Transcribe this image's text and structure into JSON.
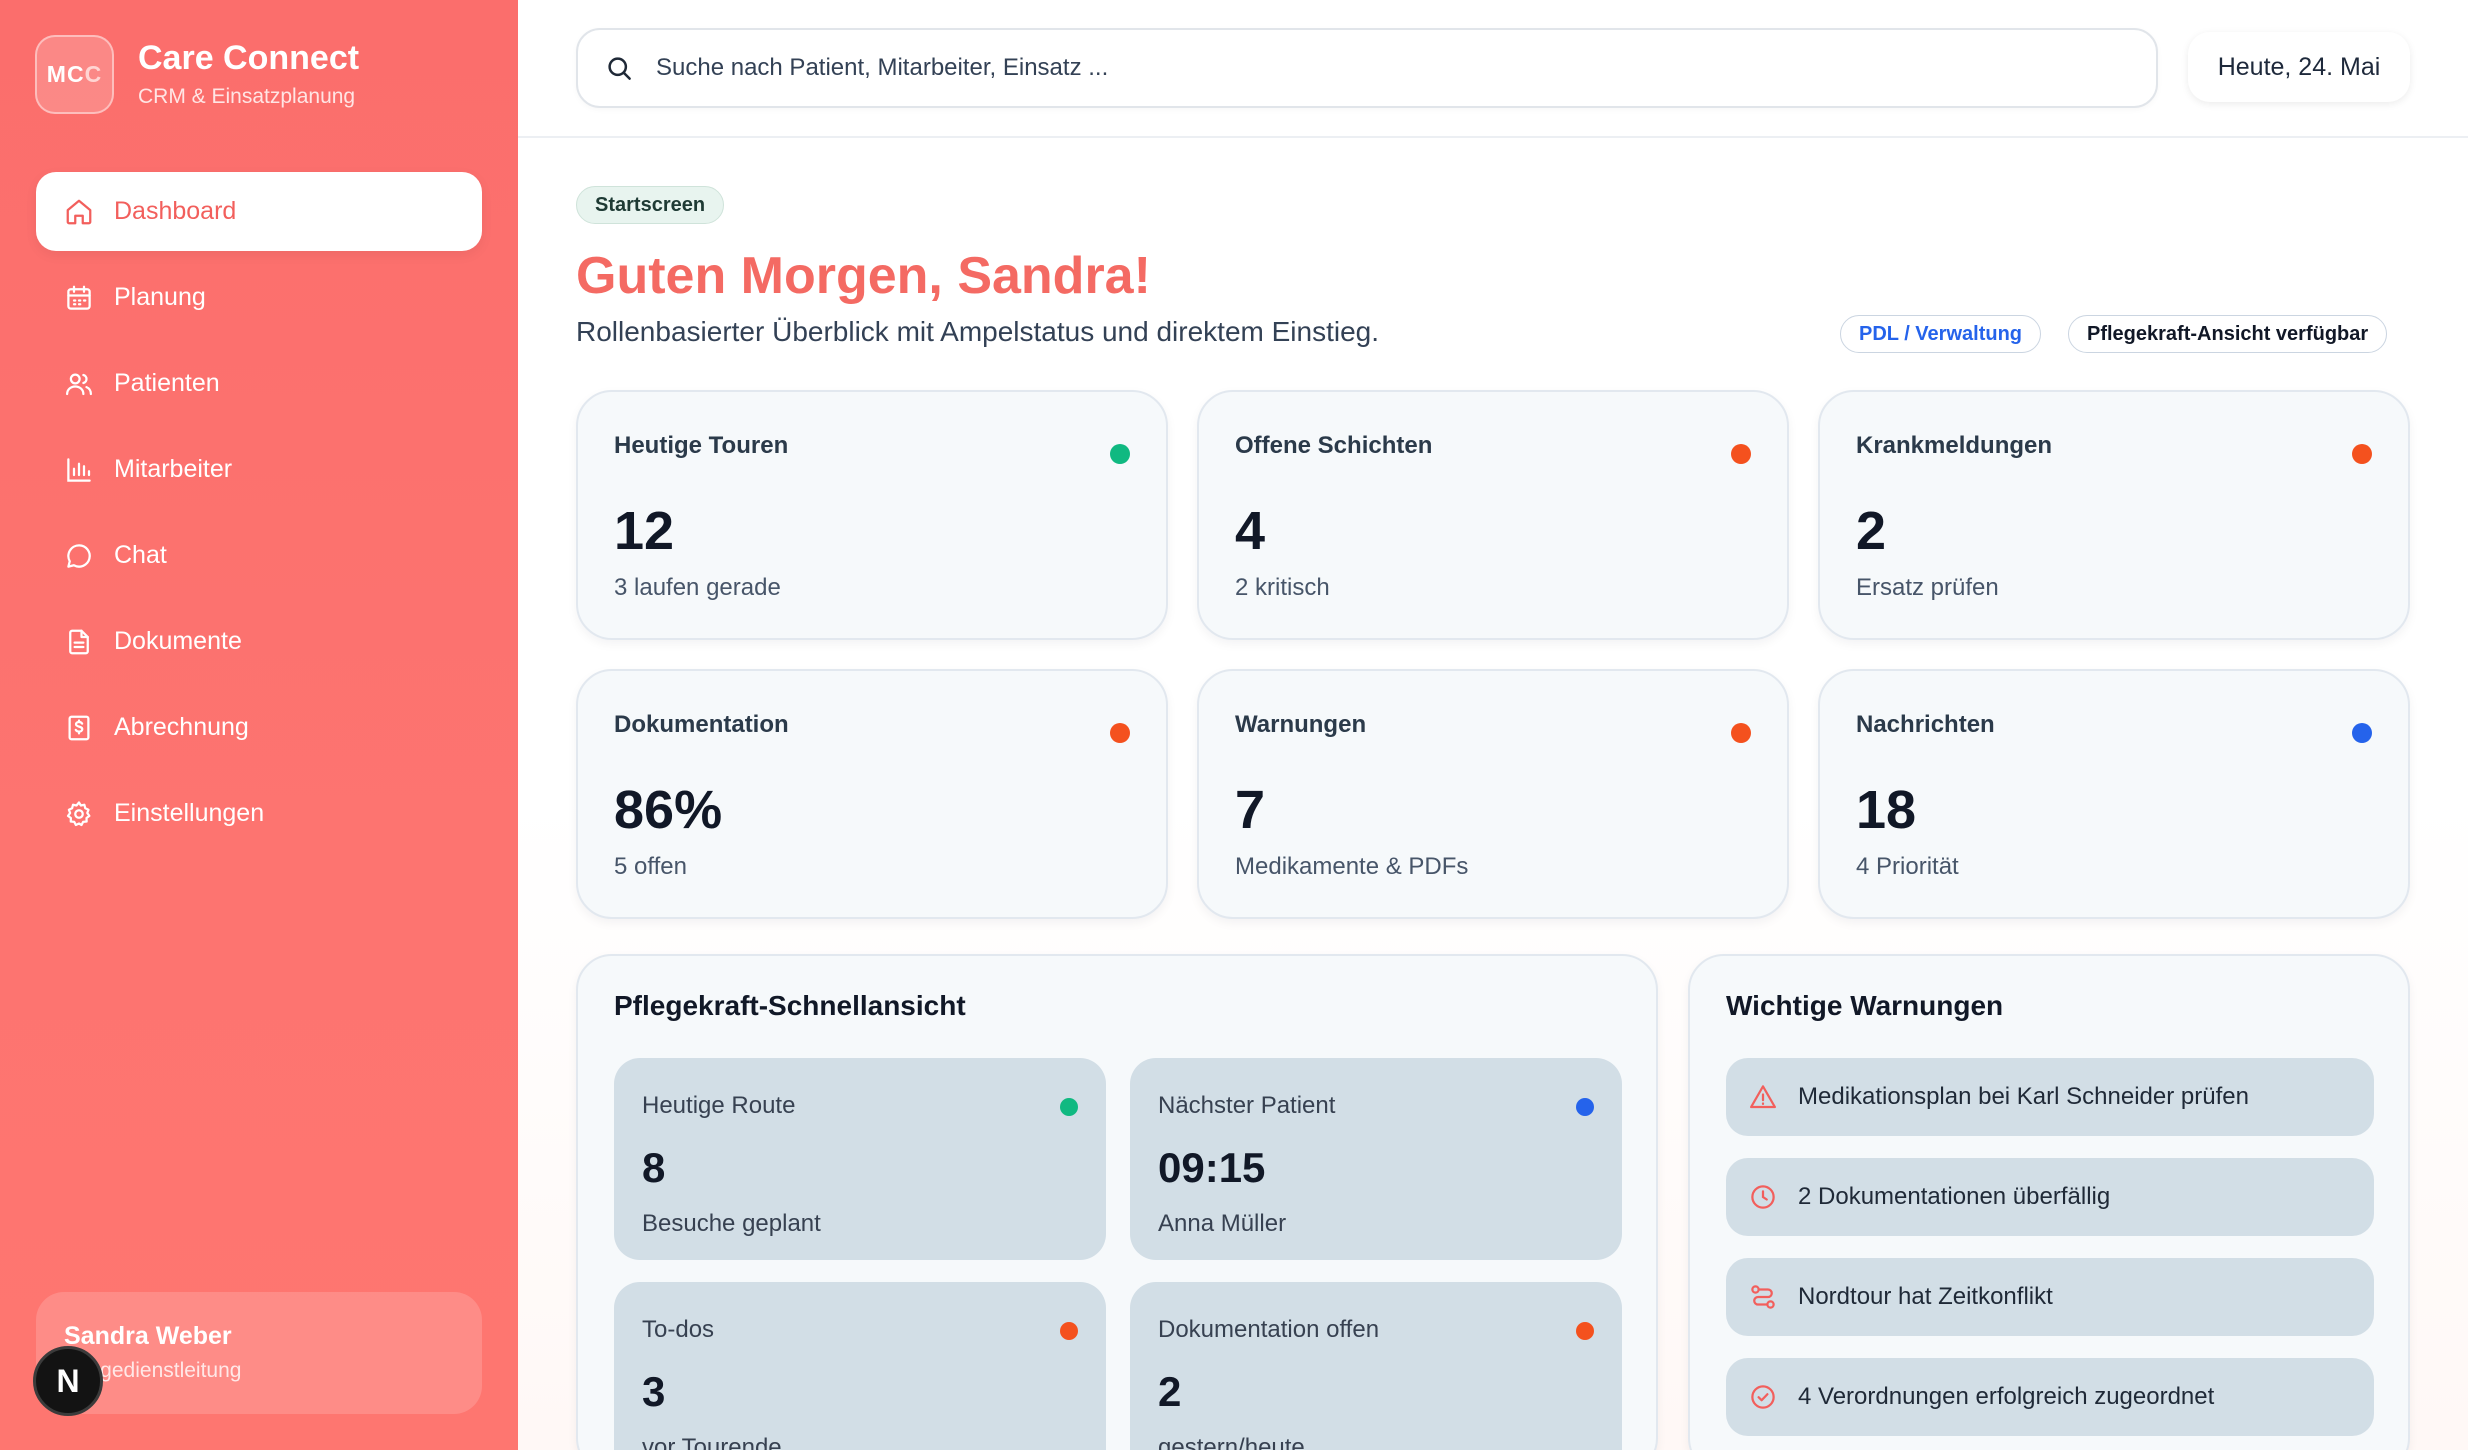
{
  "brand": {
    "logo_text": "MC",
    "logo_accent": "C",
    "name": "Care Connect",
    "subtitle": "CRM & Einsatzplanung"
  },
  "nav": {
    "items": [
      {
        "label": "Dashboard",
        "icon": "home-icon",
        "active": true
      },
      {
        "label": "Planung",
        "icon": "calendar-icon",
        "active": false
      },
      {
        "label": "Patienten",
        "icon": "users-icon",
        "active": false
      },
      {
        "label": "Mitarbeiter",
        "icon": "bar-chart-icon",
        "active": false
      },
      {
        "label": "Chat",
        "icon": "chat-icon",
        "active": false
      },
      {
        "label": "Dokumente",
        "icon": "document-icon",
        "active": false
      },
      {
        "label": "Abrechnung",
        "icon": "invoice-icon",
        "active": false
      },
      {
        "label": "Einstellungen",
        "icon": "gear-icon",
        "active": false
      }
    ]
  },
  "user": {
    "name": "Sandra Weber",
    "role": "Pflegedienstleitung",
    "badge": "N"
  },
  "header": {
    "search_placeholder": "Suche nach Patient, Mitarbeiter, Einsatz ...",
    "date": "Heute, 24. Mai"
  },
  "hero": {
    "tag": "Startscreen",
    "greeting": "Guten Morgen, Sandra!",
    "subtitle": "Rollenbasierter Überblick mit Ampelstatus und direktem Einstieg.",
    "chip_role": "PDL / Verwaltung",
    "chip_view": "Pflegekraft-Ansicht verfügbar"
  },
  "stats": [
    {
      "title": "Heutige Touren",
      "value": "12",
      "sub": "3 laufen gerade",
      "status_color": "#10b981"
    },
    {
      "title": "Offene Schichten",
      "value": "4",
      "sub": "2 kritisch",
      "status_color": "#f4511e"
    },
    {
      "title": "Krankmeldungen",
      "value": "2",
      "sub": "Ersatz prüfen",
      "status_color": "#f4511e"
    },
    {
      "title": "Dokumentation",
      "value": "86%",
      "sub": "5 offen",
      "status_color": "#f4511e"
    },
    {
      "title": "Warnungen",
      "value": "7",
      "sub": "Medikamente & PDFs",
      "status_color": "#f4511e"
    },
    {
      "title": "Nachrichten",
      "value": "18",
      "sub": "4 Priorität",
      "status_color": "#2563eb"
    }
  ],
  "quick_view": {
    "title": "Pflegekraft-Schnellansicht",
    "cards": [
      {
        "title": "Heutige Route",
        "value": "8",
        "sub": "Besuche geplant",
        "status_color": "#10b981"
      },
      {
        "title": "Nächster Patient",
        "value": "09:15",
        "sub": "Anna Müller",
        "status_color": "#2563eb"
      },
      {
        "title": "To-dos",
        "value": "3",
        "sub": "vor Tourende",
        "status_color": "#f4511e"
      },
      {
        "title": "Dokumentation offen",
        "value": "2",
        "sub": "gestern/heute",
        "status_color": "#f4511e"
      }
    ]
  },
  "warnings": {
    "title": "Wichtige Warnungen",
    "items": [
      {
        "text": "Medikationsplan bei Karl Schneider prüfen",
        "icon": "alert-triangle-icon"
      },
      {
        "text": "2 Dokumentationen überfällig",
        "icon": "clock-icon"
      },
      {
        "text": "Nordtour hat Zeitkonflikt",
        "icon": "route-icon"
      },
      {
        "text": "4 Verordnungen erfolgreich zugeordnet",
        "icon": "check-circle-icon"
      }
    ]
  },
  "colors": {
    "accent": "#f46a63",
    "sidebar": "#fd7470",
    "green": "#10b981",
    "orange": "#f4511e",
    "blue": "#2563eb"
  }
}
